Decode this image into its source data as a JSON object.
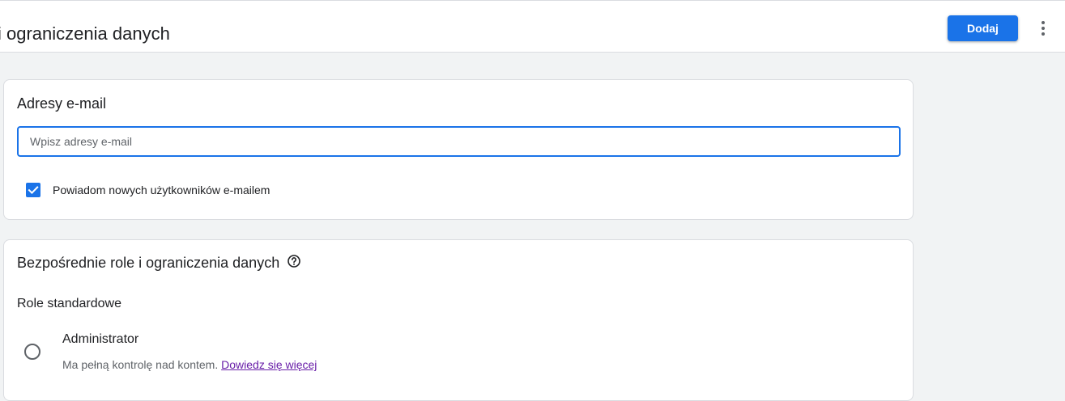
{
  "header": {
    "title": "i ograniczenia danych",
    "add_button": "Dodaj",
    "more_icon": "more-vert-icon"
  },
  "email_section": {
    "title": "Adresy e-mail",
    "input_placeholder": "Wpisz adresy e-mail",
    "input_value": "",
    "notify_checkbox": {
      "label": "Powiadom nowych użytkowników e-mailem",
      "checked": true
    }
  },
  "roles_section": {
    "title": "Bezpośrednie role i ograniczenia danych",
    "help_icon": "help-circle-icon",
    "standard_roles_label": "Role standardowe",
    "roles": [
      {
        "name": "Administrator",
        "description": "Ma pełną kontrolę nad kontem.",
        "link": "Dowiedz się więcej",
        "selected": false
      }
    ]
  },
  "colors": {
    "accent": "#1a73e8",
    "link_visited": "#681da8",
    "text_primary": "#202124",
    "text_secondary": "#5f6368",
    "background": "#f1f3f4"
  }
}
